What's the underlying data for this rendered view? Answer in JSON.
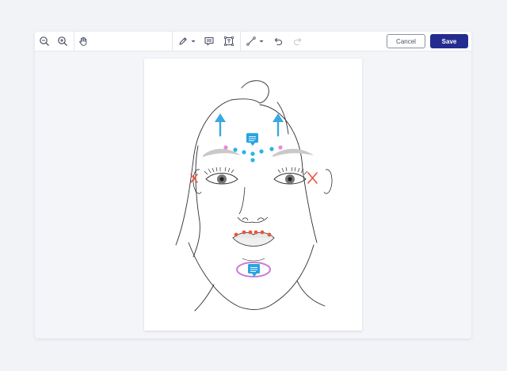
{
  "toolbar": {
    "tools": [
      {
        "name": "zoom-out-icon"
      },
      {
        "name": "zoom-in-icon"
      },
      {
        "name": "hand-pan-icon"
      },
      {
        "name": "pen-icon",
        "has_dropdown": true
      },
      {
        "name": "comment-icon"
      },
      {
        "name": "text-box-icon"
      },
      {
        "name": "line-icon",
        "has_dropdown": true
      },
      {
        "name": "undo-icon"
      },
      {
        "name": "redo-icon",
        "disabled": true
      }
    ],
    "cancel_label": "Cancel",
    "save_label": "Save"
  },
  "colors": {
    "primary": "#242d8f",
    "arrow": "#3aa8e2",
    "dot_blue": "#29b4e6",
    "dot_pink": "#e58ad9",
    "dot_red": "#e8563e",
    "cross": "#e8563e",
    "ellipse": "#c57ad9",
    "comment_marker": "#2aa4e2"
  },
  "annotations": {
    "arrows": 2,
    "comment_markers": 2,
    "forehead_dots_blue": 6,
    "forehead_dots_pink": 2,
    "lip_dots_red": 6,
    "crosses": 2,
    "chin_ellipse": 1
  }
}
